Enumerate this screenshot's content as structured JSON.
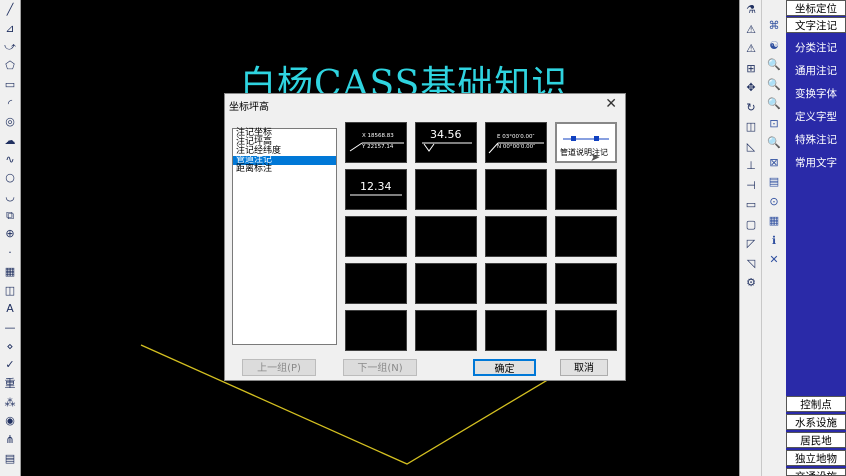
{
  "banner": {
    "title": "白杨CASS基础知识"
  },
  "left_toolbar": {
    "icons": [
      "line-icon",
      "polyline-icon",
      "arc-icon",
      "polygon-icon",
      "rectangle-icon",
      "arc2-icon",
      "circle-icon",
      "revision-cloud-icon",
      "spline-icon",
      "ellipse-icon",
      "ellipse-arc-icon",
      "insert-block-icon",
      "make-block-icon",
      "point-icon",
      "hatch-icon",
      "region-icon",
      "text-icon",
      "separator",
      "snap-icon",
      "measure-icon",
      "layer-icon",
      "group-icon",
      "camera-icon",
      "dimension-icon",
      "scale-icon"
    ],
    "glyphs": [
      "╱",
      "⊿",
      "⤻",
      "⬠",
      "▭",
      "◜",
      "◎",
      "☁",
      "∿",
      "○",
      "◡",
      "⧉",
      "⊕",
      "·",
      "▦",
      "◫",
      "A",
      "—",
      "⋄",
      "✓",
      "重",
      "⁂",
      "◉",
      "⋔",
      "▤"
    ],
    "text_button": "A",
    "heavy_glyph": "重"
  },
  "right_toolbar": {
    "glyphs": [
      "⚗",
      "⚠",
      "⚠",
      "⊞",
      "✥",
      "↻",
      "◫",
      "◺",
      "⊥",
      "⊣",
      "▭",
      "▢",
      "◸",
      "◹",
      "⚙"
    ],
    "icons": [
      "erase-icon",
      "copy-icon",
      "mirror-icon",
      "offset-icon",
      "array-icon",
      "move-icon",
      "rotate-icon",
      "scale-icon",
      "stretch-icon",
      "trim-icon",
      "extend-icon",
      "break-icon",
      "chamfer-icon",
      "fillet-icon",
      "explode-icon"
    ]
  },
  "right_toolbar2": {
    "glyphs": [
      "⌘",
      "☯",
      "🔍",
      "🔍",
      "🔍",
      "⊡",
      "🔍",
      "⊠",
      "▤",
      "⊙",
      "▦",
      "ℹ",
      "✕"
    ],
    "icons": [
      "pan-icon",
      "zoom-realtime-icon",
      "zoom-window-icon",
      "zoom-prev-icon",
      "zoom-extents-icon",
      "properties-icon",
      "match-icon",
      "layer-props-icon",
      "list-icon",
      "info-icon",
      "table-icon",
      "help-icon",
      "cancel-icon"
    ]
  },
  "menu": {
    "header": "坐标定位",
    "items": [
      "文字注记",
      "分类注记",
      "通用注记",
      "变换字体",
      "定义字型",
      "特殊注记",
      "常用文字"
    ],
    "bottom_items": [
      "控制点",
      "水系设施",
      "居民地",
      "独立地物",
      "交通设施"
    ]
  },
  "dialog": {
    "title": "坐标坪高",
    "close": "✕",
    "list": [
      "注记坐标",
      "注记坪高",
      "注记经纬度",
      "管道注记",
      "距离标注"
    ],
    "selected_index": 3,
    "cells": {
      "coord_x": "X 18568.83",
      "coord_y": "Y 22157.14",
      "elevation": "34.56",
      "latlon_e": "E 03°00′0.00″",
      "latlon_n": "N 00°00′0.00″",
      "pipe_label": "管道说明注记",
      "distance": "12.34"
    },
    "buttons": {
      "prev": "上一组(P)",
      "next": "下一组(N)",
      "ok": "确定",
      "cancel": "取消"
    }
  },
  "colors": {
    "banner": "#2fd4e0",
    "polyline": "#d4c020",
    "menu_bg": "#2a2aa8"
  }
}
